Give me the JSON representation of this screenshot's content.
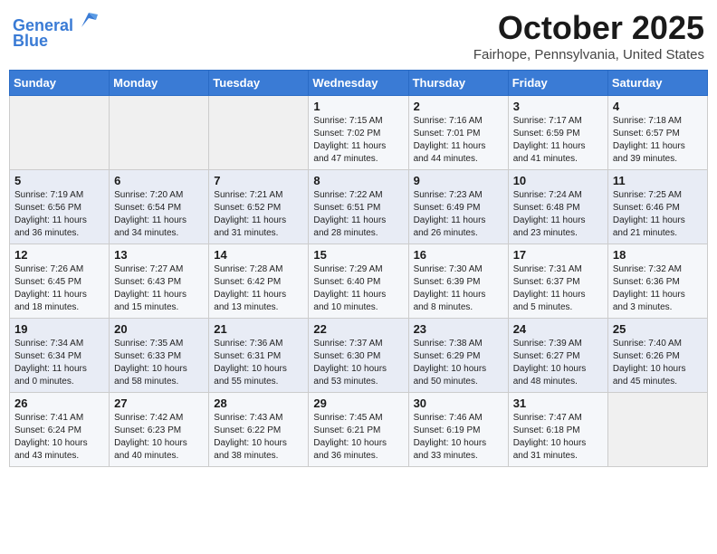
{
  "header": {
    "logo_line1": "General",
    "logo_line2": "Blue",
    "month": "October 2025",
    "location": "Fairhope, Pennsylvania, United States"
  },
  "weekdays": [
    "Sunday",
    "Monday",
    "Tuesday",
    "Wednesday",
    "Thursday",
    "Friday",
    "Saturday"
  ],
  "weeks": [
    [
      {
        "day": "",
        "info": ""
      },
      {
        "day": "",
        "info": ""
      },
      {
        "day": "",
        "info": ""
      },
      {
        "day": "1",
        "info": "Sunrise: 7:15 AM\nSunset: 7:02 PM\nDaylight: 11 hours and 47 minutes."
      },
      {
        "day": "2",
        "info": "Sunrise: 7:16 AM\nSunset: 7:01 PM\nDaylight: 11 hours and 44 minutes."
      },
      {
        "day": "3",
        "info": "Sunrise: 7:17 AM\nSunset: 6:59 PM\nDaylight: 11 hours and 41 minutes."
      },
      {
        "day": "4",
        "info": "Sunrise: 7:18 AM\nSunset: 6:57 PM\nDaylight: 11 hours and 39 minutes."
      }
    ],
    [
      {
        "day": "5",
        "info": "Sunrise: 7:19 AM\nSunset: 6:56 PM\nDaylight: 11 hours and 36 minutes."
      },
      {
        "day": "6",
        "info": "Sunrise: 7:20 AM\nSunset: 6:54 PM\nDaylight: 11 hours and 34 minutes."
      },
      {
        "day": "7",
        "info": "Sunrise: 7:21 AM\nSunset: 6:52 PM\nDaylight: 11 hours and 31 minutes."
      },
      {
        "day": "8",
        "info": "Sunrise: 7:22 AM\nSunset: 6:51 PM\nDaylight: 11 hours and 28 minutes."
      },
      {
        "day": "9",
        "info": "Sunrise: 7:23 AM\nSunset: 6:49 PM\nDaylight: 11 hours and 26 minutes."
      },
      {
        "day": "10",
        "info": "Sunrise: 7:24 AM\nSunset: 6:48 PM\nDaylight: 11 hours and 23 minutes."
      },
      {
        "day": "11",
        "info": "Sunrise: 7:25 AM\nSunset: 6:46 PM\nDaylight: 11 hours and 21 minutes."
      }
    ],
    [
      {
        "day": "12",
        "info": "Sunrise: 7:26 AM\nSunset: 6:45 PM\nDaylight: 11 hours and 18 minutes."
      },
      {
        "day": "13",
        "info": "Sunrise: 7:27 AM\nSunset: 6:43 PM\nDaylight: 11 hours and 15 minutes."
      },
      {
        "day": "14",
        "info": "Sunrise: 7:28 AM\nSunset: 6:42 PM\nDaylight: 11 hours and 13 minutes."
      },
      {
        "day": "15",
        "info": "Sunrise: 7:29 AM\nSunset: 6:40 PM\nDaylight: 11 hours and 10 minutes."
      },
      {
        "day": "16",
        "info": "Sunrise: 7:30 AM\nSunset: 6:39 PM\nDaylight: 11 hours and 8 minutes."
      },
      {
        "day": "17",
        "info": "Sunrise: 7:31 AM\nSunset: 6:37 PM\nDaylight: 11 hours and 5 minutes."
      },
      {
        "day": "18",
        "info": "Sunrise: 7:32 AM\nSunset: 6:36 PM\nDaylight: 11 hours and 3 minutes."
      }
    ],
    [
      {
        "day": "19",
        "info": "Sunrise: 7:34 AM\nSunset: 6:34 PM\nDaylight: 11 hours and 0 minutes."
      },
      {
        "day": "20",
        "info": "Sunrise: 7:35 AM\nSunset: 6:33 PM\nDaylight: 10 hours and 58 minutes."
      },
      {
        "day": "21",
        "info": "Sunrise: 7:36 AM\nSunset: 6:31 PM\nDaylight: 10 hours and 55 minutes."
      },
      {
        "day": "22",
        "info": "Sunrise: 7:37 AM\nSunset: 6:30 PM\nDaylight: 10 hours and 53 minutes."
      },
      {
        "day": "23",
        "info": "Sunrise: 7:38 AM\nSunset: 6:29 PM\nDaylight: 10 hours and 50 minutes."
      },
      {
        "day": "24",
        "info": "Sunrise: 7:39 AM\nSunset: 6:27 PM\nDaylight: 10 hours and 48 minutes."
      },
      {
        "day": "25",
        "info": "Sunrise: 7:40 AM\nSunset: 6:26 PM\nDaylight: 10 hours and 45 minutes."
      }
    ],
    [
      {
        "day": "26",
        "info": "Sunrise: 7:41 AM\nSunset: 6:24 PM\nDaylight: 10 hours and 43 minutes."
      },
      {
        "day": "27",
        "info": "Sunrise: 7:42 AM\nSunset: 6:23 PM\nDaylight: 10 hours and 40 minutes."
      },
      {
        "day": "28",
        "info": "Sunrise: 7:43 AM\nSunset: 6:22 PM\nDaylight: 10 hours and 38 minutes."
      },
      {
        "day": "29",
        "info": "Sunrise: 7:45 AM\nSunset: 6:21 PM\nDaylight: 10 hours and 36 minutes."
      },
      {
        "day": "30",
        "info": "Sunrise: 7:46 AM\nSunset: 6:19 PM\nDaylight: 10 hours and 33 minutes."
      },
      {
        "day": "31",
        "info": "Sunrise: 7:47 AM\nSunset: 6:18 PM\nDaylight: 10 hours and 31 minutes."
      },
      {
        "day": "",
        "info": ""
      }
    ]
  ]
}
